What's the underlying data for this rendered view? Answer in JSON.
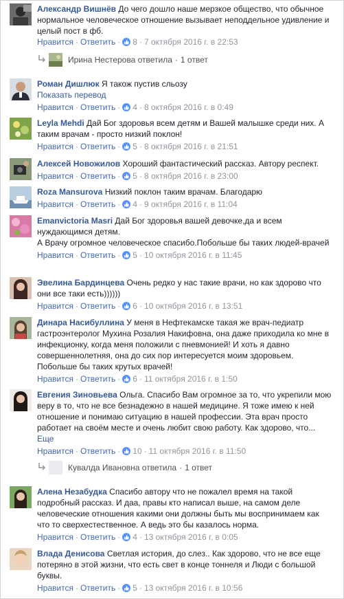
{
  "actions": {
    "like": "Нравится",
    "reply": "Ответить",
    "dot": "·"
  },
  "comments": [
    {
      "name": "Александр Вишнёв",
      "text": "До чего дошло наше мерзкое общество, что обычное нормальное человеческое отношение вызывает неподдельное удивление и целый пост в фб.",
      "likes": "8",
      "date": "7 октября 2016 г. в 22:53",
      "avatar": "avatar-man-dark"
    },
    {
      "name": "Роман Дишлюк",
      "text": "Я також пустив сльозу",
      "translate": "Показать перевод",
      "likes": "4",
      "date": "8 октября 2016 г. в 0:49",
      "avatar": "avatar-man-suit"
    },
    {
      "name": "Leyla Mehdi",
      "text": "Дай Бог здоровья всем детям и Вашей малышке среди них. А таким врачам - просто низкий поклон!",
      "likes": "5",
      "date": "8 октября 2016 г. в 21:51",
      "avatar": "avatar-flowers-green"
    },
    {
      "name": "Алексей Новожилов",
      "text": "Хороший фантастический рассказ. Автору респект.",
      "likes": "5",
      "date": "8 октября 2016 г. в 23:00",
      "avatar": "avatar-camera"
    },
    {
      "name": "Roza Mansurova",
      "text": "Низкий поклон таким врачам. Благодарю",
      "likes": "4",
      "date": "9 октября 2016 г. в 11:04",
      "avatar": "avatar-ship"
    },
    {
      "name": "Emanvictoria Masri",
      "text": "Дай Бог здоровья вашей девочке,да и всем нуждающимся детям.",
      "text2": "А Врачу огромное человеческое спасибо.Побольше бы таких людей-врачей",
      "likes": "5",
      "date": "10 октября 2016 г. в 11:45",
      "avatar": "avatar-pink-flowers"
    },
    {
      "name": "Эвелина Бардинцева",
      "text": "Очень редко у нас такие врачи, но как здорово что они все таки есть))))))",
      "likes": "6",
      "date": "10 октября 2016 г. в 13:51",
      "avatar": "avatar-woman-dark"
    },
    {
      "name": "Динара Насибуллина",
      "text": "У меня в Нефтекамске такая же врач-педиатр гастроэнтеролог Мухина Розалия Накифовна, она даже приходила ко мне в инфекционку, когда меня положили с пневмонией! И хоть я давно совершеннолетняя, она до сих пор интересуется моим здоровьем. Побольше бы таких крутых врачей!",
      "likes": "6",
      "date": "11 октября 2016 г. в 1:50",
      "avatar": "avatar-woman-outdoor"
    },
    {
      "name": "Евгения Зиновьева",
      "text": "Ольга. Спасибо Вам огромное за то, что укрепили мою веру в то, что не все безнадежно в нашей медицине. Я тоже имею к ней отношение и понимаю ситуацию в нашей профессии. Эта врач просто работает на своём месте и очень любит свою работу. Как здорово, что...",
      "more": "Еще",
      "likes": "10",
      "date": "11 октября 2016 г. в 11:50",
      "avatar": "avatar-woman-black"
    },
    {
      "name": "Алена Незабудка",
      "text": "Спасибо автору что не пожалел время на такой подробный рассказ. И даа, правы кто написал выше, на самом деле человеческие отношения какими они должны быть мы воспринимаем как что то сверхестественное. А ведь это бы казалось норма.",
      "likes": "4",
      "date": "13 октября 2016 г. в 0:05",
      "avatar": "avatar-woman-green"
    },
    {
      "name": "Влада Денисова",
      "text": "Светлая история, до слез.. Как здорово, что не все еще потеряно в этой жизни, что есть свет в конце тоннеля и Люди с большой буквы.",
      "likes": "5",
      "date": "13 октября 2016 г. в 10:56",
      "avatar": "avatar-baby"
    }
  ],
  "replies": [
    {
      "name": "Ирина Нестерова",
      "verb": "ответила",
      "count": "1 ответ",
      "avatar": "avatar-landscape"
    },
    {
      "name": "Кувалда Ивановна",
      "verb": "ответила",
      "count": "1 ответ",
      "avatar": "avatar-blank"
    }
  ],
  "colors": {
    "link": "#365899",
    "action": "#4267b2",
    "meta": "#90949c",
    "like": "#5890ff"
  }
}
